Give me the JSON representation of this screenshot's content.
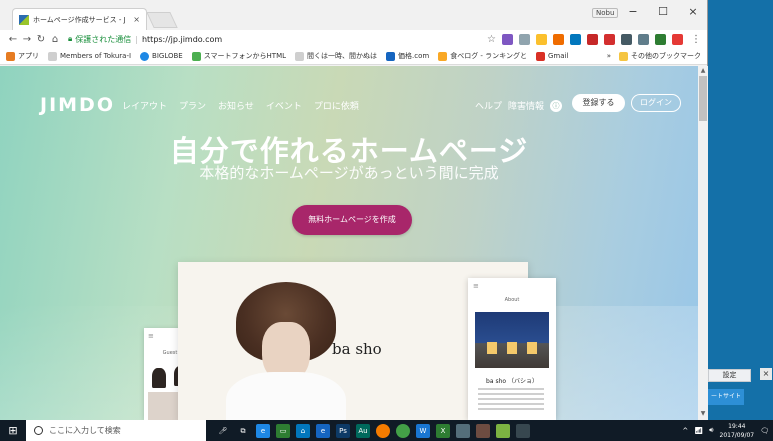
{
  "browser": {
    "tab_title": "ホームページ作成サービス - J",
    "tab_close": "×",
    "profile": "Nobu",
    "minimize": "−",
    "maximize": "☐",
    "close": "×",
    "secure_label": "保護された通信",
    "separator": "|",
    "url": "https://jp.jimdo.com",
    "bookmarks": [
      {
        "label": "アプリ",
        "color": "#e67c22"
      },
      {
        "label": "Members of Tokura-I",
        "color": "#9e9e9e"
      },
      {
        "label": "BIGLOBE",
        "color": "#1e88e5"
      },
      {
        "label": "スマートフォンからHTML",
        "color": "#4caf50"
      },
      {
        "label": "間くは一時、間かぬは",
        "color": "#9e9e9e"
      },
      {
        "label": "価格.com",
        "color": "#1565c0"
      },
      {
        "label": "食べログ - ランキングと",
        "color": "#f9a825"
      },
      {
        "label": "Gmail",
        "color": "#d93025"
      }
    ],
    "bookmarks_more": "»",
    "other_bookmarks": "その他のブックマーク"
  },
  "site": {
    "logo": "JIMDO",
    "nav": [
      "レイアウト",
      "プラン",
      "お知らせ",
      "イベント",
      "プロに依頼"
    ],
    "help": "ヘルプ",
    "fault_info": "障害情報",
    "lang_icon": "ⓘ",
    "register": "登録する",
    "login": "ログイン",
    "hero_title": "自分で作れるホームページ",
    "hero_sub": "本格的なホームページがあっという間に完成",
    "cta": "無料ホームページを作成",
    "mock_brand": "ba sho",
    "mock_left_label": "Guest",
    "mock_right_label": "About",
    "mock_right_name": "ba sho （バショ）"
  },
  "desktop": {
    "settings": "設定",
    "close": "×",
    "support": "ートサイト"
  },
  "taskbar": {
    "search_placeholder": "ここに入力して検索",
    "time": "19:44",
    "date": "2017/09/07"
  },
  "colors": {
    "cta": "#a8266a",
    "hero_left": "#8fd3bf",
    "hero_right": "#98c6e8",
    "taskbar": "#101b26"
  }
}
